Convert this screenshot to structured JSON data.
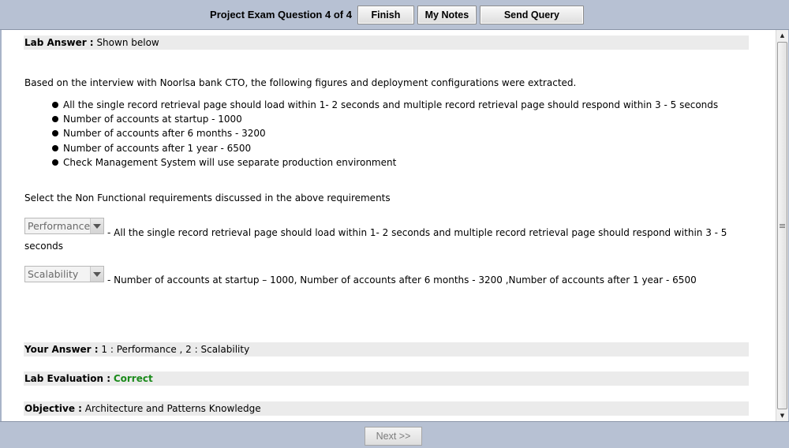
{
  "header": {
    "title": "Project Exam Question 4 of 4",
    "buttons": {
      "finish": "Finish",
      "my_notes": "My Notes",
      "send_query": "Send Query"
    }
  },
  "lab_answer": {
    "label": "Lab Answer :",
    "value": "Shown below"
  },
  "intro": "Based on the interview with Noorlsa bank CTO, the following figures and deployment configurations were extracted.",
  "bullets": [
    "All the single record retrieval page should load within 1- 2 seconds and multiple record retrieval page should respond within 3 - 5 seconds",
    "Number of accounts at startup - 1000",
    "Number of accounts after 6 months - 3200",
    "Number of accounts after 1 year - 6500",
    "Check Management System will use separate production environment"
  ],
  "instruction": "Select the Non Functional requirements discussed in the above requirements",
  "requirements": [
    {
      "selected": "Performance",
      "text_line1": "- All the single record retrieval page should load within 1- 2 seconds and multiple record retrieval page should respond within 3 - 5",
      "text_line2": "seconds"
    },
    {
      "selected": "Scalability",
      "text_line1": "- Number of accounts at startup – 1000, Number of accounts after 6 months - 3200 ,Number of accounts after 1 year - 6500"
    }
  ],
  "your_answer": {
    "label": "Your Answer :",
    "value": "1 : Performance , 2 : Scalability"
  },
  "evaluation": {
    "label": "Lab Evaluation :",
    "value": "Correct"
  },
  "objective": {
    "label": "Objective :",
    "value": "Architecture and Patterns Knowledge"
  },
  "footer": {
    "next": "Next >>"
  },
  "colors": {
    "bar_bg": "#b7c1d3",
    "band_bg": "#ebebeb",
    "correct": "#1a8a1a"
  }
}
